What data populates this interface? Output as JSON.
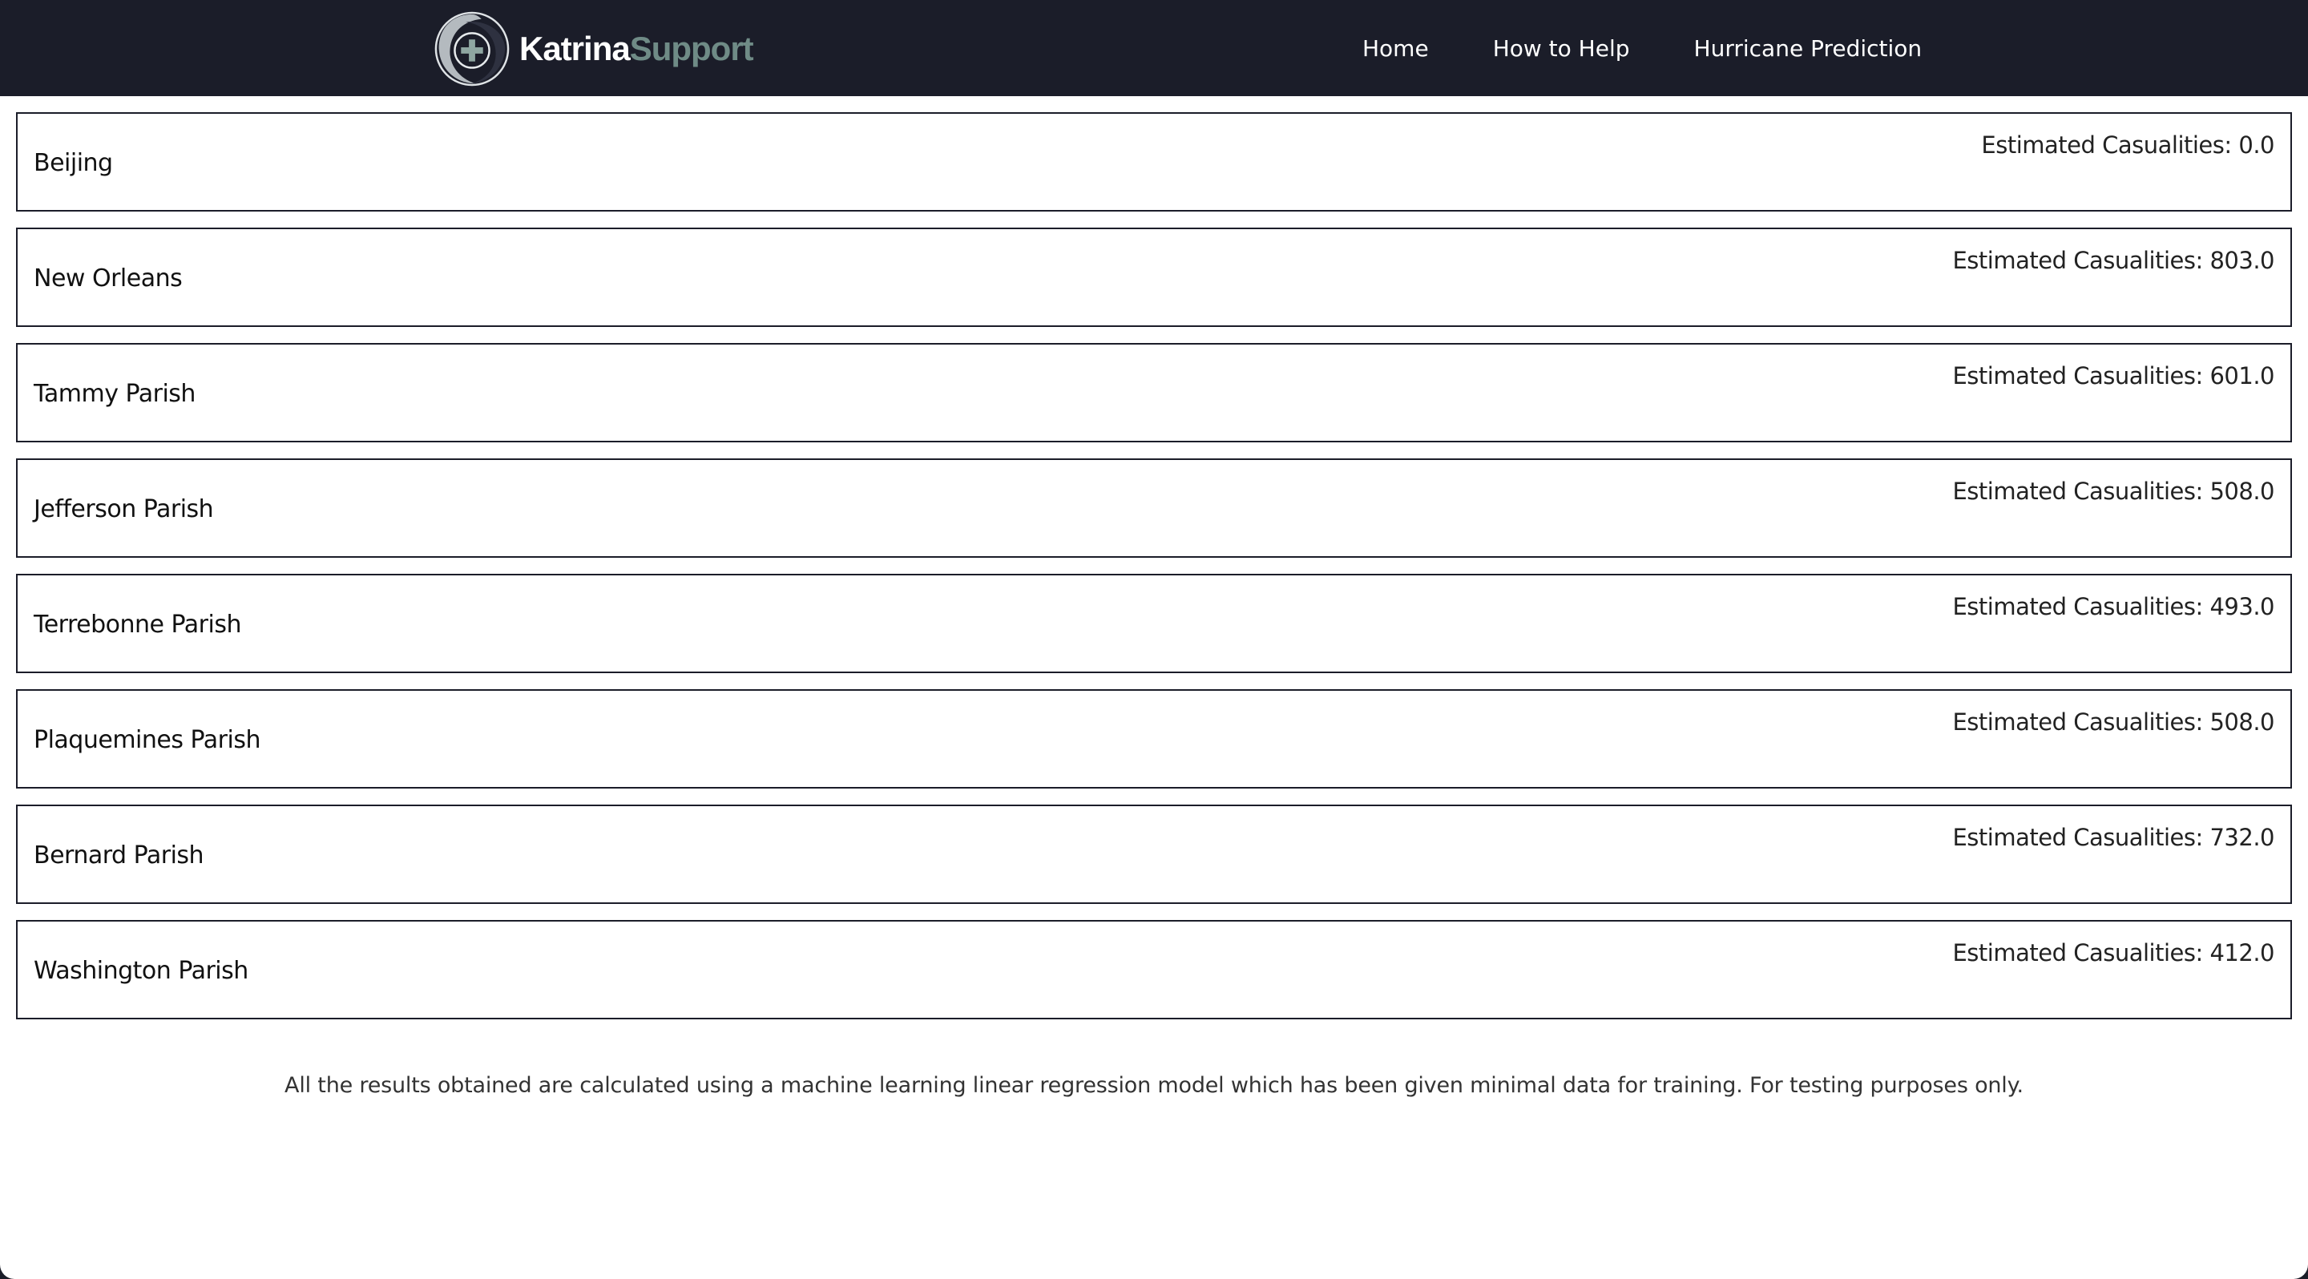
{
  "brand": {
    "name_part1": "Katrina",
    "name_part2": "Support",
    "logo_icon": "hurricane-cross-icon",
    "colors": {
      "navbar": "#1b1d29",
      "accent": "#6f8b86"
    }
  },
  "nav": {
    "items": [
      {
        "label": "Home"
      },
      {
        "label": "How to Help"
      },
      {
        "label": "Hurricane Prediction"
      }
    ]
  },
  "results": {
    "rows": [
      {
        "location": "Beijing",
        "estimate": "Estimated Casualities: 0.0"
      },
      {
        "location": "New Orleans",
        "estimate": "Estimated Casualities: 803.0"
      },
      {
        "location": "Tammy Parish",
        "estimate": "Estimated Casualities: 601.0"
      },
      {
        "location": "Jefferson Parish",
        "estimate": "Estimated Casualities: 508.0"
      },
      {
        "location": "Terrebonne Parish",
        "estimate": "Estimated Casualities: 493.0"
      },
      {
        "location": "Plaquemines Parish",
        "estimate": "Estimated Casualities: 508.0"
      },
      {
        "location": "Bernard Parish",
        "estimate": "Estimated Casualities: 732.0"
      },
      {
        "location": "Washington Parish",
        "estimate": "Estimated Casualities: 412.0"
      }
    ]
  },
  "footer": {
    "disclaimer": "All the results obtained are calculated using a machine learning linear regression model which has been given minimal data for training. For testing purposes only."
  }
}
